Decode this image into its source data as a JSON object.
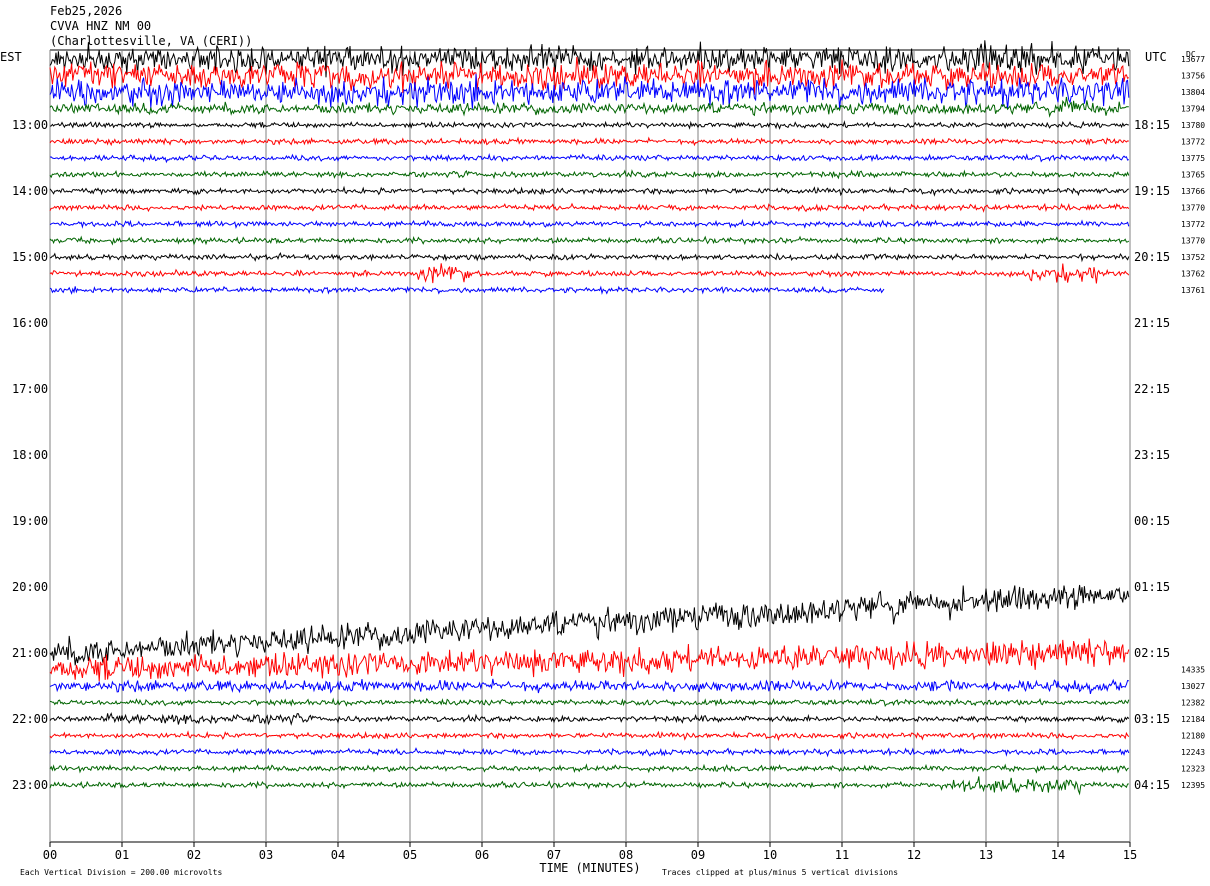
{
  "header": {
    "date": "Feb25,2026",
    "station": "CVVA HNZ NM 00",
    "location": "(Charlottesville, VA (CERI))"
  },
  "chart_data": {
    "type": "line",
    "title": "",
    "left_axis_label": "EST",
    "right_axis_label": "UTC",
    "dc_label": "DC",
    "xlabel": "TIME (MINUTES)",
    "x_ticks": [
      "00",
      "01",
      "02",
      "03",
      "04",
      "05",
      "06",
      "07",
      "08",
      "09",
      "10",
      "11",
      "12",
      "13",
      "14",
      "15"
    ],
    "xlim": [
      0,
      15
    ],
    "left_hour_labels": [
      "13:00",
      "14:00",
      "15:00",
      "16:00",
      "17:00",
      "18:00",
      "19:00",
      "20:00",
      "21:00",
      "22:00",
      "23:00"
    ],
    "right_hour_labels": [
      "18:15",
      "19:15",
      "20:15",
      "21:15",
      "22:15",
      "23:15",
      "00:15",
      "01:15",
      "02:15",
      "03:15",
      "04:15"
    ],
    "trace_colors": [
      "#000000",
      "#ff0000",
      "#0000ff",
      "#006400"
    ],
    "footer_scale": "Each Vertical Division =  200.00 microvolts",
    "footer_clip": "Traces clipped at plus/minus 5 vertical divisions",
    "traces": [
      {
        "row": 0,
        "color": "#000000",
        "dc": "13677",
        "end_minute": 15,
        "amplitude": "clipped"
      },
      {
        "row": 1,
        "color": "#ff0000",
        "dc": "13756",
        "end_minute": 15,
        "amplitude": "clipped"
      },
      {
        "row": 2,
        "color": "#0000ff",
        "dc": "13804",
        "end_minute": 15,
        "amplitude": "clipped"
      },
      {
        "row": 3,
        "color": "#006400",
        "dc": "13794",
        "end_minute": 15,
        "amplitude": "medium"
      },
      {
        "row": 4,
        "color": "#000000",
        "dc": "13780",
        "end_minute": 15,
        "amplitude": "low"
      },
      {
        "row": 5,
        "color": "#ff0000",
        "dc": "13772",
        "end_minute": 15,
        "amplitude": "low"
      },
      {
        "row": 6,
        "color": "#0000ff",
        "dc": "13775",
        "end_minute": 15,
        "amplitude": "low"
      },
      {
        "row": 7,
        "color": "#006400",
        "dc": "13765",
        "end_minute": 15,
        "amplitude": "low"
      },
      {
        "row": 8,
        "color": "#000000",
        "dc": "13766",
        "end_minute": 15,
        "amplitude": "low"
      },
      {
        "row": 9,
        "color": "#ff0000",
        "dc": "13770",
        "end_minute": 15,
        "amplitude": "low"
      },
      {
        "row": 10,
        "color": "#0000ff",
        "dc": "13772",
        "end_minute": 15,
        "amplitude": "low"
      },
      {
        "row": 11,
        "color": "#006400",
        "dc": "13770",
        "end_minute": 15,
        "amplitude": "low"
      },
      {
        "row": 12,
        "color": "#000000",
        "dc": "13752",
        "end_minute": 15,
        "amplitude": "low"
      },
      {
        "row": 13,
        "color": "#ff0000",
        "dc": "13762",
        "end_minute": 15,
        "amplitude": "low"
      },
      {
        "row": 14,
        "color": "#0000ff",
        "dc": "13761",
        "end_minute": 11.6,
        "amplitude": "low"
      },
      {
        "row": 36,
        "color": "#000000",
        "dc": "",
        "end_minute": 15,
        "amplitude": "clipped"
      },
      {
        "row": 37,
        "color": "#ff0000",
        "dc": "14335",
        "end_minute": 15,
        "amplitude": "clipped"
      },
      {
        "row": 38,
        "color": "#0000ff",
        "dc": "13027",
        "end_minute": 15,
        "amplitude": "medium"
      },
      {
        "row": 39,
        "color": "#006400",
        "dc": "12382",
        "end_minute": 15,
        "amplitude": "low"
      },
      {
        "row": 40,
        "color": "#000000",
        "dc": "12184",
        "end_minute": 15,
        "amplitude": "low"
      },
      {
        "row": 41,
        "color": "#ff0000",
        "dc": "12180",
        "end_minute": 15,
        "amplitude": "low"
      },
      {
        "row": 42,
        "color": "#0000ff",
        "dc": "12243",
        "end_minute": 15,
        "amplitude": "low"
      },
      {
        "row": 43,
        "color": "#006400",
        "dc": "12323",
        "end_minute": 15,
        "amplitude": "low"
      },
      {
        "row": 44,
        "color": "#006400",
        "dc": "12395",
        "end_minute": 15,
        "amplitude": "low"
      }
    ]
  }
}
